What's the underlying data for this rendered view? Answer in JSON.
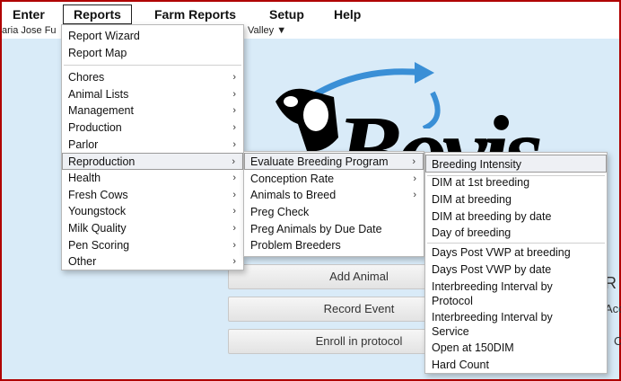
{
  "menubar": {
    "items": [
      "Enter",
      "Reports",
      "Farm Reports",
      "Setup",
      "Help"
    ]
  },
  "subbar": {
    "user": "aria Jose Fu",
    "farm": "Valley",
    "farm_caret": "▼"
  },
  "reports_menu": {
    "top_items": [
      "Report Wizard",
      "Report Map"
    ],
    "sub_items": [
      "Chores",
      "Animal Lists",
      "Management",
      "Production",
      "Parlor",
      "Reproduction",
      "Health",
      "Fresh Cows",
      "Youngstock",
      "Milk Quality",
      "Pen Scoring",
      "Other"
    ]
  },
  "reproduction_menu": {
    "items": [
      "Evaluate Breeding Program",
      "Conception Rate",
      "Animals to Breed",
      "Preg Check",
      "Preg Animals by Due Date",
      "Problem Breeders"
    ]
  },
  "evaluate_menu": {
    "items": [
      "Breeding Intensity",
      "DIM at 1st breeding",
      "DIM at breeding",
      "DIM at breeding by date",
      "Day of breeding",
      "Days Post VWP at breeding",
      "Days Post VWP by date",
      "Interbreeding Interval by Protocol",
      "Interbreeding Interval by Service",
      "Open at 150DIM",
      "Hard Count"
    ]
  },
  "arrow_glyph": "›",
  "logo": {
    "text": "Bovis"
  },
  "actions": {
    "add_animal": "Add Animal",
    "record_event": "Record Event",
    "enroll_protocol": "Enroll in protocol"
  },
  "partials": {
    "r": "R",
    "acc": "Acc",
    "c": "C"
  },
  "colors": {
    "frame": "#b00000",
    "background": "#d9ebf8",
    "arrow_blue": "#3a8fd6"
  }
}
